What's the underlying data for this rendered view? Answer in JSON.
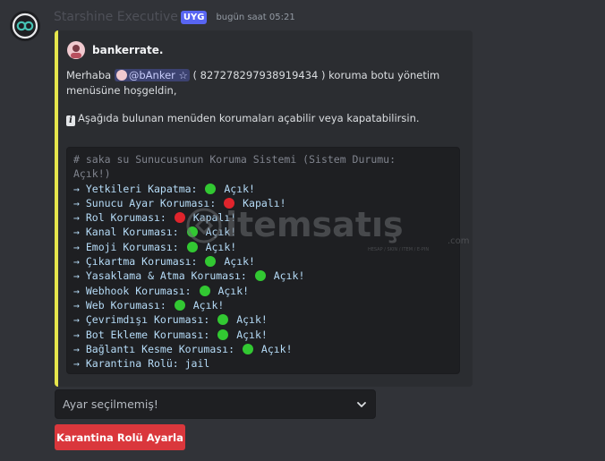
{
  "message": {
    "username": "Starshine Executive",
    "app_badge": "UYG",
    "timestamp": "bugün saat 05:21"
  },
  "embed": {
    "accent_color": "#e6e64c",
    "author": "bankerrate.",
    "desc1_pre": "Merhaba",
    "mention": "@bAnker ☆",
    "desc1_post": "( 827278297938919434 ) koruma botu yönetim",
    "desc2": "menüsüne hoşgeldin,",
    "desc3": "Aşağıda bulunan menüden korumaları açabilir veya kapatabilirsin.",
    "code": {
      "comment1": "# saka su Sunucusunun Koruma Sistemi (Sistem Durumu:",
      "comment2": "Açık!)",
      "items": [
        {
          "label": "→ Yetkileri Kapatma:",
          "status": "Açık!",
          "color": "green"
        },
        {
          "label": "→ Sunucu Ayar Koruması:",
          "status": "Kapalı!",
          "color": "red"
        },
        {
          "label": "→ Rol Koruması:",
          "status": "Kapalı!",
          "color": "red"
        },
        {
          "label": "→ Kanal Koruması:",
          "status": "Açık!",
          "color": "green"
        },
        {
          "label": "→ Emoji Koruması:",
          "status": "Açık!",
          "color": "green"
        },
        {
          "label": "→ Çıkartma Koruması:",
          "status": "Açık!",
          "color": "green"
        },
        {
          "label": "→ Yasaklama & Atma Koruması:",
          "status": "Açık!",
          "color": "green"
        },
        {
          "label": "→ Webhook Koruması:",
          "status": "Açık!",
          "color": "green"
        },
        {
          "label": "→ Web Koruması:",
          "status": "Açık!",
          "color": "green"
        },
        {
          "label": "→ Çevrimdışı Koruması:",
          "status": "Açık!",
          "color": "green"
        },
        {
          "label": "→ Bot Ekleme Koruması:",
          "status": "Açık!",
          "color": "green"
        },
        {
          "label": "→ Bağlantı Kesme Koruması:",
          "status": "Açık!",
          "color": "green"
        }
      ],
      "last_line": "→ Karantina Rolü: jail"
    }
  },
  "watermark": {
    "brand": "itemsatış",
    "tagline": "HESAP / SKIN / ITEM / E-PIN",
    "suffix": ".com"
  },
  "select": {
    "placeholder": "Ayar seçilmemiş!",
    "icon": "chevron-down-icon"
  },
  "button": {
    "label": "Karantina Rolü Ayarla",
    "color": "#da373c"
  }
}
